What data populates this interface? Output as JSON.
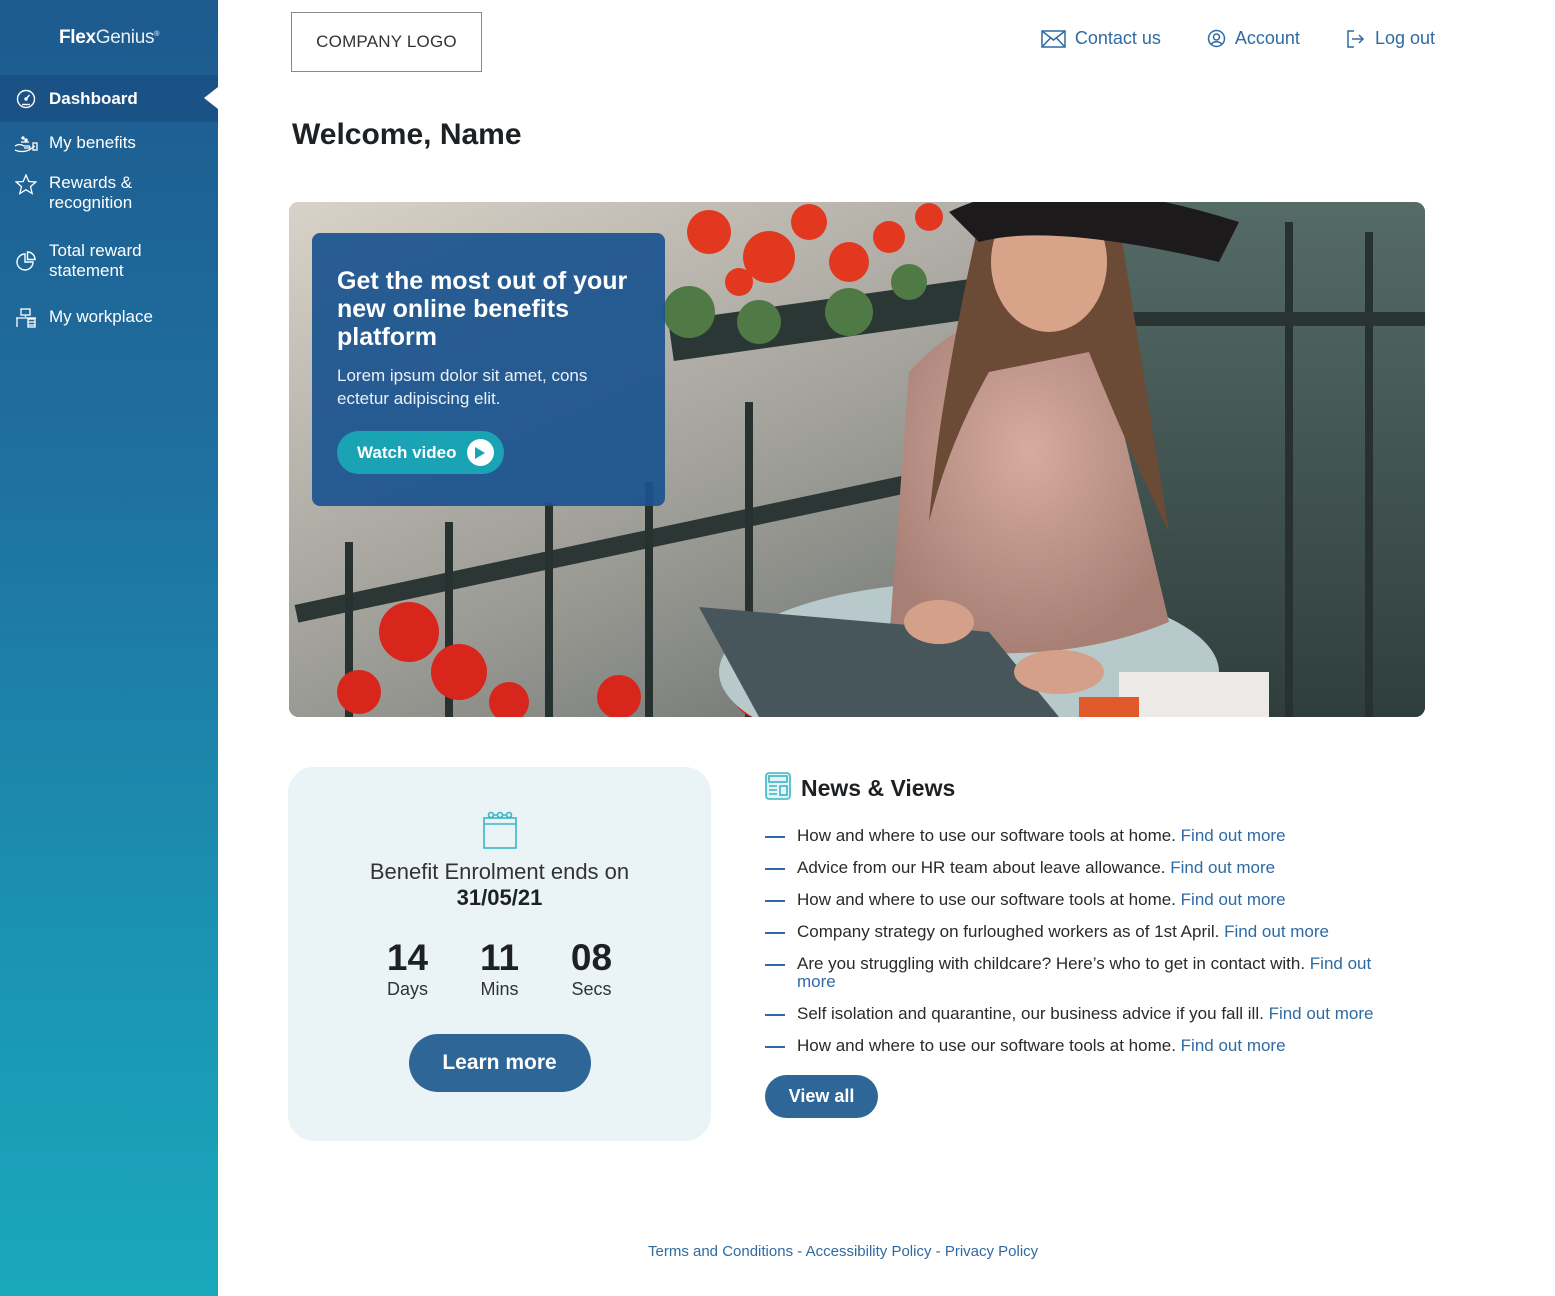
{
  "brand": {
    "name_bold": "Flex",
    "name_light": "Genius",
    "mark": "®"
  },
  "sidebar": {
    "items": [
      {
        "label": "Dashboard",
        "icon": "dashboard-gauge-icon",
        "active": true
      },
      {
        "label": "My benefits",
        "icon": "hand-benefits-icon",
        "active": false
      },
      {
        "label": "Rewards & recognition",
        "icon": "star-icon",
        "active": false
      },
      {
        "label": "Total reward statement",
        "icon": "pie-chart-icon",
        "active": false
      },
      {
        "label": "My workplace",
        "icon": "workplace-desk-icon",
        "active": false
      }
    ]
  },
  "header": {
    "logo_text": "COMPANY LOGO",
    "links": [
      {
        "label": "Contact us",
        "icon": "envelope-icon"
      },
      {
        "label": "Account",
        "icon": "user-circle-icon"
      },
      {
        "label": "Log out",
        "icon": "logout-icon"
      }
    ]
  },
  "welcome": "Welcome, Name",
  "hero": {
    "title": "Get the most out of your new online benefits platform",
    "subtitle": "Lorem ipsum dolor sit amet, cons ectetur adipiscing elit.",
    "button_label": "Watch video",
    "image_alt": "Woman smiling while working on a laptop on a balcony with red flowers"
  },
  "countdown": {
    "text": "Benefit Enrolment ends on",
    "date": "31/05/21",
    "units": [
      {
        "value": "14",
        "label": "Days"
      },
      {
        "value": "11",
        "label": "Mins"
      },
      {
        "value": "08",
        "label": "Secs"
      }
    ],
    "button_label": "Learn more"
  },
  "news": {
    "title": "News & Views",
    "link_label": "Find out more",
    "items": [
      {
        "text": "How and where to use our software tools at home."
      },
      {
        "text": "Advice from our HR team about leave allowance."
      },
      {
        "text": "How and where to use our software tools at home."
      },
      {
        "text": "Company strategy on furloughed workers as of 1st April."
      },
      {
        "text": "Are you struggling with childcare? Here’s who to get in contact with."
      },
      {
        "text": "Self isolation and quarantine, our business advice if you fall ill."
      },
      {
        "text": "How and where to use our software tools at home."
      }
    ],
    "view_all_label": "View all"
  },
  "footer": {
    "links": [
      "Terms and Conditions",
      "Accessibility Policy",
      "Privacy Policy"
    ],
    "separator": " - "
  },
  "colors": {
    "primary": "#2f6698",
    "link": "#2f6aa3",
    "accent_teal": "#1aa2b5",
    "sidebar_top": "#1d5a8e",
    "sidebar_bottom": "#1aa8bb",
    "card_bg": "#eaf4f7"
  }
}
